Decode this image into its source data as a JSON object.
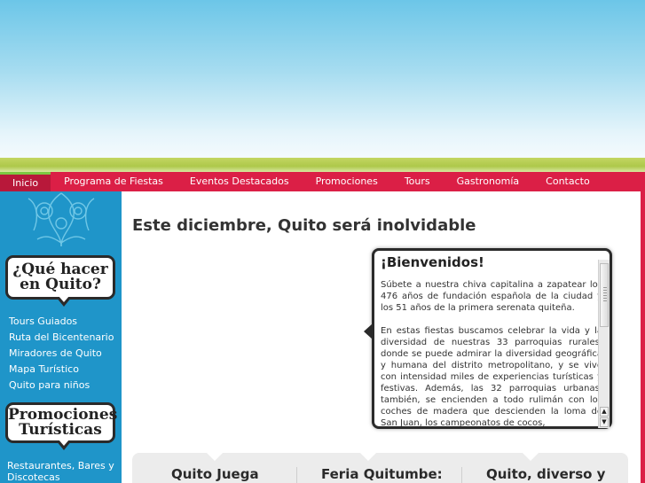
{
  "nav": {
    "items": [
      {
        "label": "Inicio"
      },
      {
        "label": "Programa de Fiestas"
      },
      {
        "label": "Eventos Destacados"
      },
      {
        "label": "Promociones"
      },
      {
        "label": "Tours"
      },
      {
        "label": "Gastronomía"
      },
      {
        "label": "Contacto"
      }
    ]
  },
  "sidebar": {
    "heading1": {
      "line1": "¿Qué hacer",
      "line2": "en Quito?"
    },
    "links1": [
      "Tours Guiados",
      "Ruta del Bicentenario",
      "Miradores de Quito",
      "Mapa Turístico",
      "Quito para niños"
    ],
    "heading2": {
      "line1": "Promociones",
      "line2": "Turísticas"
    },
    "links2": [
      "Restaurantes, Bares y Discotecas"
    ]
  },
  "main": {
    "title": "Este diciembre, Quito será inolvidable",
    "welcome": {
      "title": "¡Bienvenidos!",
      "paragraphs": [
        "Súbete a nuestra chiva capitalina a zapatear los 476 años de fundación española de la ciudad y los 51 años de la primera serenata quiteña.",
        "En estas fiestas buscamos celebrar la vida y la diversidad de nuestras 33 parroquias rurales, donde se puede admirar la diversidad geográfica y humana del distrito metropolitano, y se vive con intensidad miles de experiencias turísticas y festivas. Además, las 32 parroquias urbanas, también, se encienden a todo rulimán con los coches de madera que descienden la loma de San Juan, los campeonatos de cocos,"
      ]
    },
    "cards": [
      {
        "title": "Quito Juega"
      },
      {
        "title": "Feria Quitumbe:"
      },
      {
        "title": "Quito, diverso y"
      }
    ]
  },
  "colors": {
    "nav_red": "#db1f46",
    "sidebar_blue": "#1f95c9",
    "band_green": "#aec84a"
  }
}
